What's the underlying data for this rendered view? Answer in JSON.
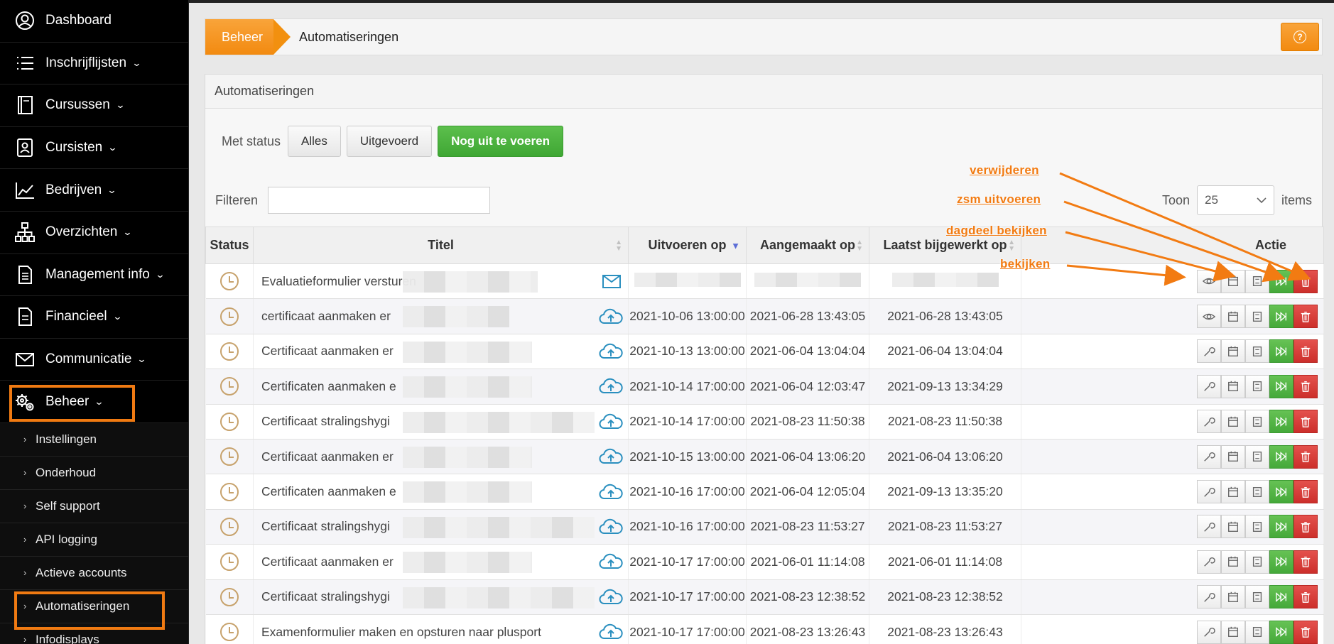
{
  "sidebar": {
    "items": [
      {
        "label": "Dashboard",
        "chev": "",
        "icon": "user-circle-icon"
      },
      {
        "label": "Inschrijflijsten",
        "chev": "⌄",
        "icon": "list-icon"
      },
      {
        "label": "Cursussen",
        "chev": "⌄",
        "icon": "book-icon"
      },
      {
        "label": "Cursisten",
        "chev": "⌄",
        "icon": "person-card-icon"
      },
      {
        "label": "Bedrijven",
        "chev": "⌄",
        "icon": "chart-line-icon"
      },
      {
        "label": "Overzichten",
        "chev": "⌄",
        "icon": "sitemap-icon"
      },
      {
        "label": "Management info",
        "chev": "⌄",
        "icon": "document-icon"
      },
      {
        "label": "Financieel",
        "chev": "⌄",
        "icon": "file-icon"
      },
      {
        "label": "Communicatie",
        "chev": "⌄",
        "icon": "envelope-icon"
      },
      {
        "label": "Beheer",
        "chev": "⌄",
        "icon": "gears-icon"
      }
    ],
    "subitems": [
      {
        "label": "Instellingen"
      },
      {
        "label": "Onderhoud"
      },
      {
        "label": "Self support"
      },
      {
        "label": "API logging"
      },
      {
        "label": "Actieve accounts"
      },
      {
        "label": "Automatiseringen"
      },
      {
        "label": "Infodisplays"
      }
    ]
  },
  "breadcrumb": {
    "home": "Beheer",
    "current": "Automatiseringen",
    "help_icon": "?"
  },
  "panel": {
    "title": "Automatiseringen",
    "status_label": "Met status",
    "status_buttons": [
      "Alles",
      "Uitgevoerd",
      "Nog uit te voeren"
    ],
    "filter_label": "Filteren",
    "filter_value": "",
    "toon_label": "Toon",
    "toon_value": "25",
    "items_label": "items"
  },
  "table": {
    "headers": [
      "Status",
      "Titel",
      "Uitvoeren op",
      "Aangemaakt op",
      "Laatst bijgewerkt op",
      "Actie"
    ],
    "rows": [
      {
        "title": "Evaluatieformulier versturen",
        "type": "mail",
        "run": "",
        "created": "",
        "updated": "",
        "first": "view"
      },
      {
        "title": "certificaat aanmaken er",
        "type": "cloud",
        "run": "2021-10-06 13:00:00",
        "created": "2021-06-28 13:43:05",
        "updated": "2021-06-28 13:43:05",
        "first": "view"
      },
      {
        "title": "Certificaat aanmaken er",
        "type": "cloud",
        "run": "2021-10-13 13:00:00",
        "created": "2021-06-04 13:04:04",
        "updated": "2021-06-04 13:04:04",
        "first": "edit"
      },
      {
        "title": "Certificaten aanmaken e",
        "type": "cloud",
        "run": "2021-10-14 17:00:00",
        "created": "2021-06-04 12:03:47",
        "updated": "2021-09-13 13:34:29",
        "first": "edit"
      },
      {
        "title": "Certificaat stralingshygi",
        "type": "cloud",
        "run": "2021-10-14 17:00:00",
        "created": "2021-08-23 11:50:38",
        "updated": "2021-08-23 11:50:38",
        "first": "edit"
      },
      {
        "title": "Certificaat aanmaken er",
        "type": "cloud",
        "run": "2021-10-15 13:00:00",
        "created": "2021-06-04 13:06:20",
        "updated": "2021-06-04 13:06:20",
        "first": "edit"
      },
      {
        "title": "Certificaten aanmaken e",
        "type": "cloud",
        "run": "2021-10-16 17:00:00",
        "created": "2021-06-04 12:05:04",
        "updated": "2021-09-13 13:35:20",
        "first": "edit"
      },
      {
        "title": "Certificaat stralingshygi",
        "type": "cloud",
        "run": "2021-10-16 17:00:00",
        "created": "2021-08-23 11:53:27",
        "updated": "2021-08-23 11:53:27",
        "first": "edit"
      },
      {
        "title": "Certificaat aanmaken er",
        "type": "cloud",
        "run": "2021-10-17 17:00:00",
        "created": "2021-06-01 11:14:08",
        "updated": "2021-06-01 11:14:08",
        "first": "edit"
      },
      {
        "title": "Certificaat stralingshygi",
        "type": "cloud",
        "run": "2021-10-17 17:00:00",
        "created": "2021-08-23 12:38:52",
        "updated": "2021-08-23 12:38:52",
        "first": "edit"
      },
      {
        "title": "Examenformulier maken en opsturen naar plusport",
        "type": "cloud",
        "run": "2021-10-17 17:00:00",
        "created": "2021-08-23 13:26:43",
        "updated": "2021-08-23 13:26:43",
        "first": "edit"
      }
    ]
  },
  "annotations": {
    "verwijderen": "verwijderen",
    "zsm": "zsm uitvoeren",
    "dagdeel": "dagdeel bekijken",
    "bekijken": "bekijken",
    "color": "#f27b12"
  }
}
